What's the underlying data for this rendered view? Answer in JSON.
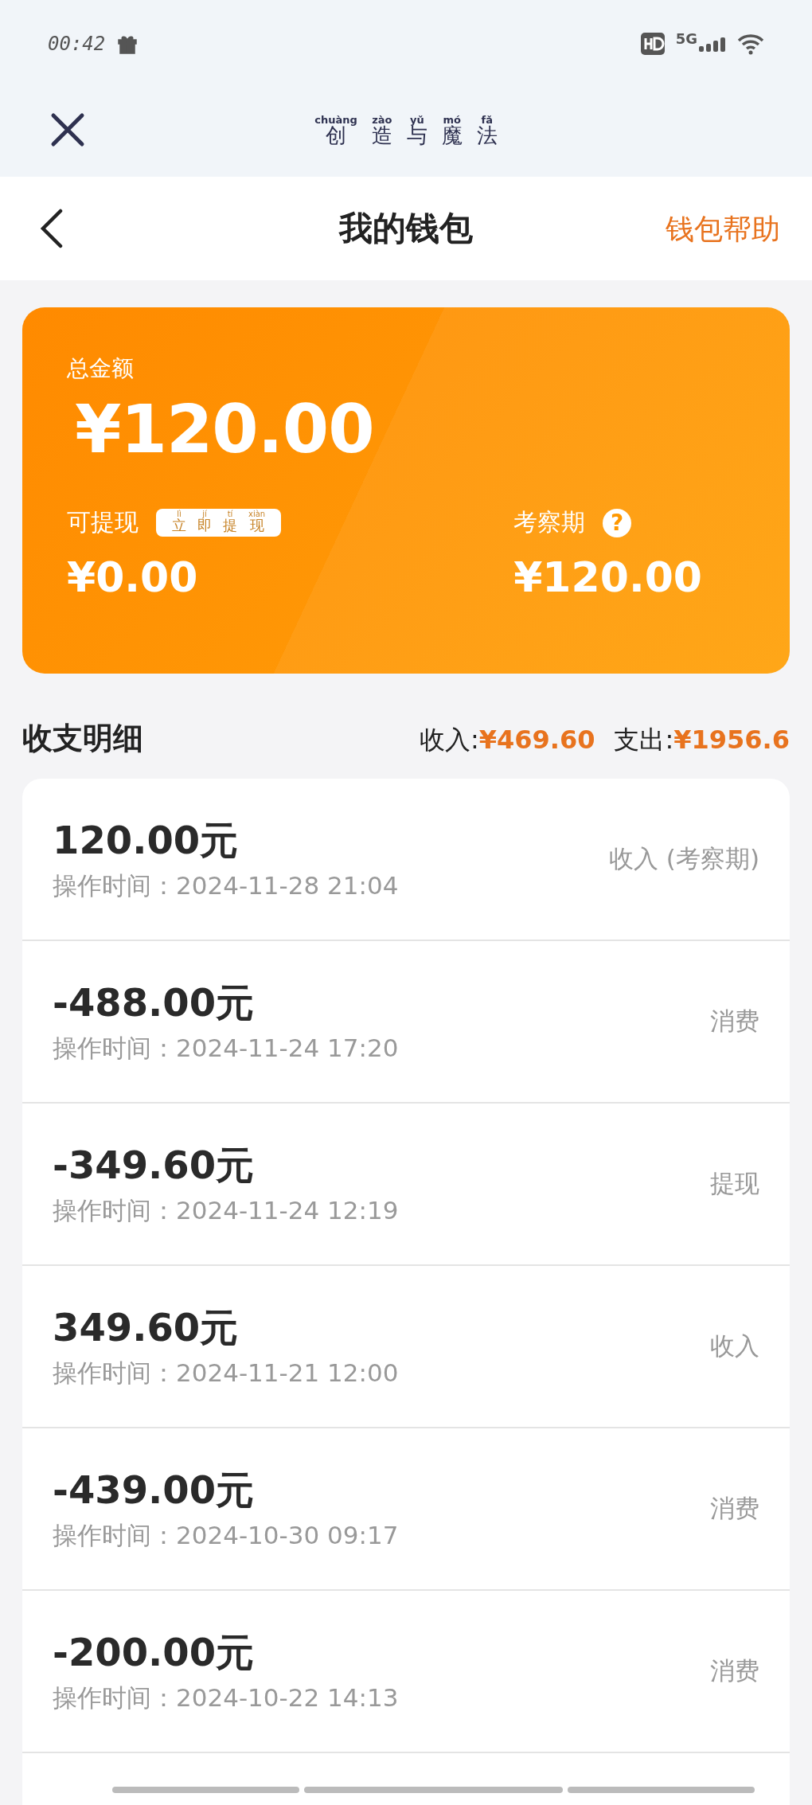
{
  "status_bar": {
    "time": "00:42",
    "network": "5G"
  },
  "app_header": {
    "title": [
      {
        "hanzi": "创",
        "pinyin": "chuàng"
      },
      {
        "hanzi": "造",
        "pinyin": "zào"
      },
      {
        "hanzi": "与",
        "pinyin": "yǔ"
      },
      {
        "hanzi": "魔",
        "pinyin": "mó"
      },
      {
        "hanzi": "法",
        "pinyin": "fǎ"
      }
    ]
  },
  "nav": {
    "title": "我的钱包",
    "help": "钱包帮助"
  },
  "wallet": {
    "total_label": "总金额",
    "total": "¥120.00",
    "withdrawable_label": "可提现",
    "withdraw_button": [
      {
        "hanzi": "立",
        "pinyin": "lì"
      },
      {
        "hanzi": "即",
        "pinyin": "jí"
      },
      {
        "hanzi": "提",
        "pinyin": "tí"
      },
      {
        "hanzi": "现",
        "pinyin": "xiàn"
      }
    ],
    "withdrawable": "¥0.00",
    "probation_label": "考察期",
    "help_mark": "?",
    "probation": "¥120.00"
  },
  "details": {
    "title": "收支明细",
    "income_label": "收入:",
    "income": "¥469.60",
    "expense_label": "支出:",
    "expense": "¥1956.6"
  },
  "records": [
    {
      "amount": "120.00元",
      "time": "操作时间：2024-11-28 21:04",
      "type": "收入 (考察期)"
    },
    {
      "amount": "-488.00元",
      "time": "操作时间：2024-11-24 17:20",
      "type": "消费"
    },
    {
      "amount": "-349.60元",
      "time": "操作时间：2024-11-24 12:19",
      "type": "提现"
    },
    {
      "amount": "349.60元",
      "time": "操作时间：2024-11-21 12:00",
      "type": "收入"
    },
    {
      "amount": "-439.00元",
      "time": "操作时间：2024-10-30 09:17",
      "type": "消费"
    },
    {
      "amount": "-200.00元",
      "time": "操作时间：2024-10-22 14:13",
      "type": "消费"
    }
  ]
}
